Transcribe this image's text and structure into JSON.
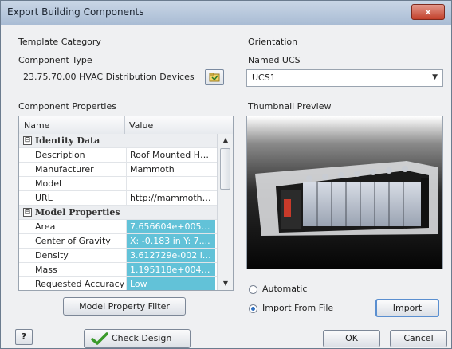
{
  "window": {
    "title": "Export Building Components",
    "close_glyph": "×"
  },
  "template_category": {
    "label": "Template Category"
  },
  "component_type": {
    "label": "Component Type",
    "value": "23.75.70.00  HVAC Distribution Devices"
  },
  "orientation": {
    "label": "Orientation"
  },
  "named_ucs": {
    "label": "Named UCS",
    "value": "UCS1"
  },
  "properties": {
    "label": "Component Properties",
    "columns": {
      "name": "Name",
      "value": "Value"
    },
    "categories": [
      {
        "toggle": "⊟",
        "name": "Identity Data"
      },
      {
        "toggle": "⊟",
        "name": "Model Properties"
      }
    ],
    "rows": [
      {
        "name": "Description",
        "value": "Roof Mounted HVAC"
      },
      {
        "name": "Manufacturer",
        "value": "Mammoth"
      },
      {
        "name": "Model",
        "value": ""
      },
      {
        "name": "URL",
        "value": "http://mammothw..."
      },
      {
        "name": "Area",
        "value": "7.656604e+005 i..."
      },
      {
        "name": "Center of Gravity",
        "value": "X: -0.183 in Y: 7...."
      },
      {
        "name": "Density",
        "value": "3.612729e-002 lb..."
      },
      {
        "name": "Mass",
        "value": "1.195118e+004 l..."
      },
      {
        "name": "Requested Accuracy",
        "value": "Low"
      }
    ]
  },
  "thumbnail": {
    "label": "Thumbnail Preview"
  },
  "options": {
    "automatic_label": "Automatic",
    "import_from_file_label": "Import From File",
    "selected": "import_from_file"
  },
  "buttons": {
    "model_property_filter": "Model Property Filter",
    "import": "Import",
    "help": "?",
    "check_design": "Check Design",
    "ok": "OK",
    "cancel": "Cancel"
  },
  "colors": {
    "highlight": "#62c2d8",
    "title_bar": "#b8c8dc",
    "close": "#c9432d"
  },
  "icons": {
    "browse": "browse-icon",
    "check": "check-mark-icon",
    "help": "help-icon"
  }
}
